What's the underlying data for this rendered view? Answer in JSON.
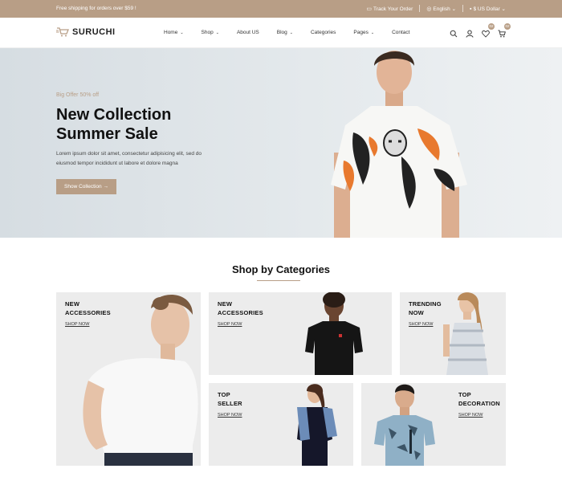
{
  "topbar": {
    "shipping": "Free shipping for orders over $59 !",
    "track": "Track Your Order",
    "language": "English",
    "currency": "$ US Dollar"
  },
  "header": {
    "logo": "SURUCHI",
    "nav": [
      {
        "label": "Home",
        "dropdown": true
      },
      {
        "label": "Shop",
        "dropdown": true
      },
      {
        "label": "About US",
        "dropdown": false
      },
      {
        "label": "Blog",
        "dropdown": true
      },
      {
        "label": "Categories",
        "dropdown": false
      },
      {
        "label": "Pages",
        "dropdown": true
      },
      {
        "label": "Contact",
        "dropdown": false
      }
    ],
    "wishlist_count": "02",
    "cart_count": "02"
  },
  "hero": {
    "offer": "Big Offer 50% off",
    "title_line1": "New Collection",
    "title_line2": "Summer Sale",
    "desc": "Lorem ipsum dolor sit amet, consectetur adipisicing elit, sed do eiusmod tempor incididunt ut labore et dolore magna",
    "button": "Show Collection"
  },
  "categories": {
    "title": "Shop by Categories",
    "cards": [
      {
        "line1": "NEW",
        "line2": "ACCESSORIES",
        "shop": "SHOP NOW"
      },
      {
        "line1": "NEW",
        "line2": "ACCESSORIES",
        "shop": "SHOP NOW"
      },
      {
        "line1": "TRENDING",
        "line2": "NOW",
        "shop": "SHOP NOW"
      },
      {
        "line1": "TOP",
        "line2": "SELLER",
        "shop": "SHOP NOW"
      },
      {
        "line1": "TOP",
        "line2": "DECORATION",
        "shop": "SHOP NOW"
      }
    ]
  },
  "colors": {
    "accent": "#b89e86",
    "card_bg": "#ececec",
    "hero_bg": "#dfe5e9"
  }
}
